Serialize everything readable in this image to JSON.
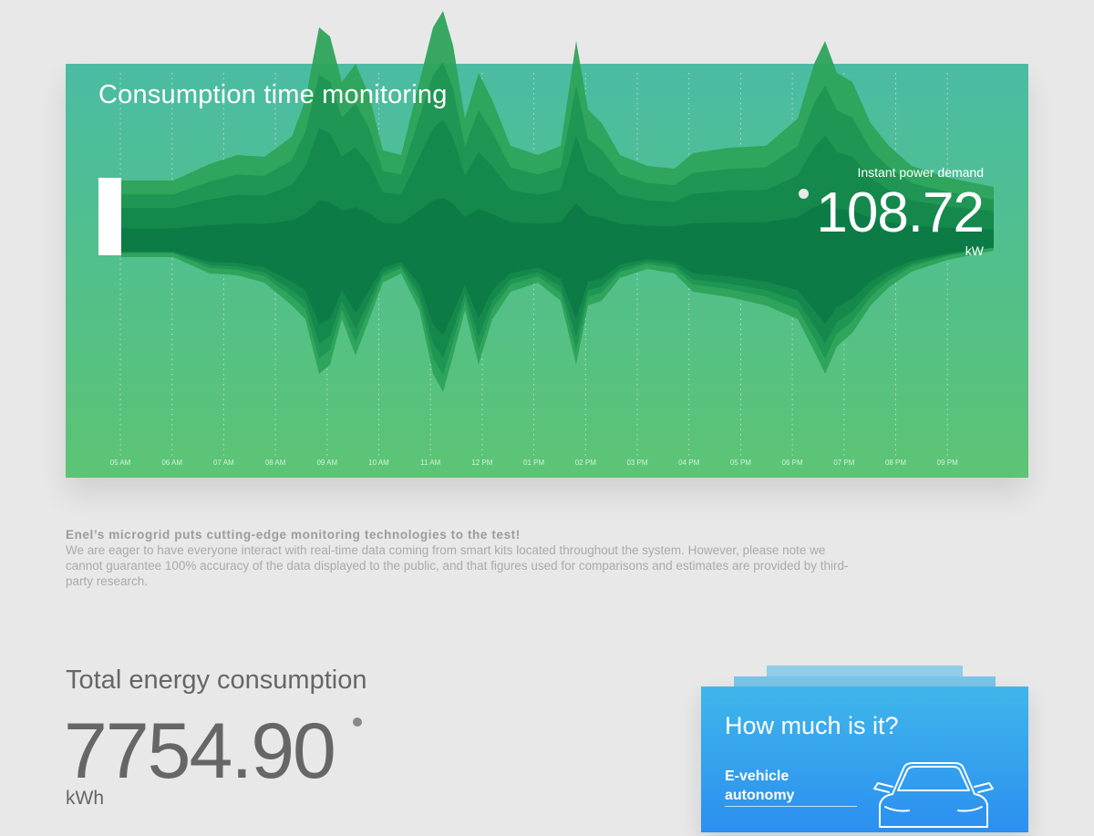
{
  "monitor": {
    "title": "Consumption time monitoring",
    "power_label": "Instant power demand",
    "power_value": "108.72",
    "power_unit": "kW",
    "time_labels": [
      "05 AM",
      "06 AM",
      "07 AM",
      "08 AM",
      "09 AM",
      "10 AM",
      "11 AM",
      "12 PM",
      "01 PM",
      "02 PM",
      "03 PM",
      "04 PM",
      "05 PM",
      "06 PM",
      "07 PM",
      "08 PM",
      "09 PM"
    ],
    "colors": {
      "band_outer": "#2da35a",
      "band_mid": "#1f9552",
      "band_inner": "#15874c",
      "band_core": "#0c7a45"
    }
  },
  "intro": {
    "headline": "Enel’s microgrid puts cutting-edge monitoring technologies to the test!",
    "body": "We are eager to have everyone interact with real-time data coming from smart kits located throughout the system. However, please note we cannot guarantee 100% accuracy of the data displayed to the public, and that figures used for comparisons and estimates are provided by third-party research."
  },
  "total": {
    "label": "Total energy consumption",
    "value": "7754.90",
    "unit": "kWh"
  },
  "card": {
    "title": "How much is it?",
    "item_label": "E-vehicle autonomy",
    "icon": "car-icon"
  }
}
